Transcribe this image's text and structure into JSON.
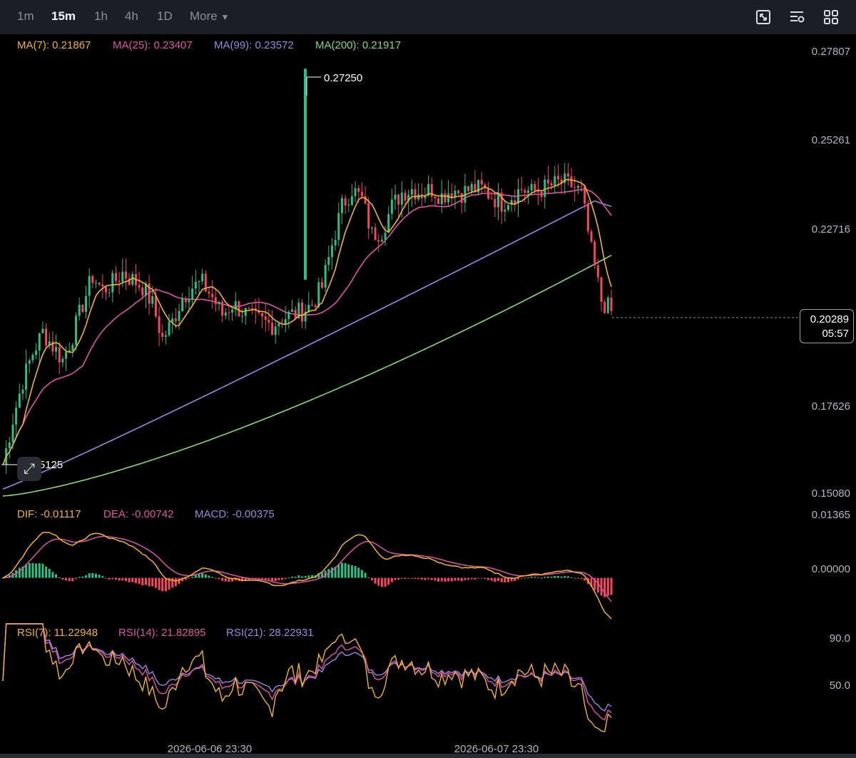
{
  "toolbar": {
    "timeframes": [
      "1m",
      "15m",
      "1h",
      "4h",
      "1D"
    ],
    "active": "15m",
    "more_label": "More",
    "icons": [
      "fullscreen-icon",
      "settings-list-icon",
      "grid-layout-icon"
    ]
  },
  "colors": {
    "ma7": "#f0b429",
    "ma25": "#e052a8",
    "ma99": "#9a86e0",
    "ma200": "#8bd67a",
    "up": "#2ebd85",
    "down": "#f6465d",
    "dif": "#f0b429",
    "dea": "#e052a8",
    "macd": "#9a86e0",
    "rsi7": "#f0b429",
    "rsi14": "#e052a8",
    "rsi21": "#9a86e0"
  },
  "price_legend": {
    "ma7": "MA(7): 0.21867",
    "ma25": "MA(25): 0.23407",
    "ma99": "MA(99): 0.23572",
    "ma200": "MA(200): 0.21917"
  },
  "macd_legend": {
    "dif": "DIF: -0.01117",
    "dea": "DEA: -0.00742",
    "macd": "MACD: -0.00375"
  },
  "rsi_legend": {
    "rsi7": "RSI(7): 11.22948",
    "rsi14": "RSI(14): 21.82895",
    "rsi21": "RSI(21): 28.22931"
  },
  "price_axis": [
    "0.27807",
    "0.25261",
    "0.22716",
    "0.20289",
    "0.17626",
    "0.15080"
  ],
  "macd_axis": [
    "0.01365",
    "0.00000"
  ],
  "rsi_axis": [
    "90.0",
    "50.0"
  ],
  "time_axis": [
    "2026-06-06 23:30",
    "2026-06-07 23:30"
  ],
  "annotations": {
    "high": "0.27250",
    "low": "0.15125",
    "current_price": "0.20289",
    "countdown": "05:57"
  },
  "chart_data": [
    {
      "type": "candlestick",
      "title": "",
      "ylim": [
        0.1508,
        0.27807
      ],
      "high_marker": 0.2725,
      "low_marker": 0.15125,
      "current_price": 0.20289,
      "close_path": [
        0.159,
        0.172,
        0.183,
        0.191,
        0.197,
        0.193,
        0.189,
        0.196,
        0.205,
        0.213,
        0.209,
        0.211,
        0.214,
        0.212,
        0.21,
        0.205,
        0.195,
        0.2,
        0.207,
        0.21,
        0.211,
        0.207,
        0.202,
        0.205,
        0.203,
        0.201,
        0.2,
        0.199,
        0.201,
        0.202,
        0.203,
        0.205,
        0.21,
        0.222,
        0.233,
        0.238,
        0.235,
        0.225,
        0.226,
        0.233,
        0.237,
        0.238,
        0.237,
        0.238,
        0.236,
        0.238,
        0.237,
        0.238,
        0.238,
        0.236,
        0.234,
        0.236,
        0.238,
        0.237,
        0.238,
        0.239,
        0.24,
        0.239,
        0.237,
        0.22,
        0.206,
        0.203
      ],
      "ma7": 0.21867,
      "ma25": 0.23407,
      "ma99": 0.23572,
      "ma200": 0.21917
    },
    {
      "type": "line",
      "title": "MACD",
      "ylim": [
        -0.009,
        0.01365
      ],
      "dif": -0.01117,
      "dea": -0.00742,
      "macd": -0.00375
    },
    {
      "type": "line",
      "title": "RSI",
      "ylim": [
        0,
        100
      ],
      "rsi7": 11.22948,
      "rsi14": 21.82895,
      "rsi21": 28.22931
    }
  ]
}
